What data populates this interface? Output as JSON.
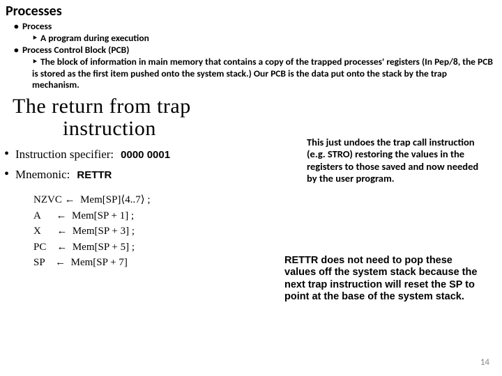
{
  "title": "Processes",
  "bullets": {
    "b1": "Process",
    "b1a": "A program during execution",
    "b2": "Process Control Block (PCB)",
    "b2a": "The block of information in main memory that contains a copy of the trapped processes' registers (In Pep/8, the PCB is stored as the first item pushed onto the system stack.)  Our PCB is the data put onto the stack by the trap mechanism."
  },
  "big_title_l1": "The return from trap",
  "big_title_l2": "instruction",
  "spec": {
    "label": "Instruction specifier:",
    "value": "0000 0001"
  },
  "mnem": {
    "label": "Mnemonic:",
    "value": "RETTR"
  },
  "math": {
    "r1": "NZVC ←  Mem[SP]⟨4..7⟩ ;",
    "r2": "A      ←  Mem[SP + 1] ;",
    "r3": "X      ←  Mem[SP + 3] ;",
    "r4": "PC    ←  Mem[SP + 5] ;",
    "r5": "SP    ←  Mem[SP + 7]"
  },
  "note1": "This just undoes the trap call instruction (e.g. STRO) restoring the values in the registers to those saved and now needed by the user program.",
  "note2": "RETTR does not need to pop these values off the system stack because the next trap instruction will reset the SP to point at the base of the system stack.",
  "pagenum": "14"
}
